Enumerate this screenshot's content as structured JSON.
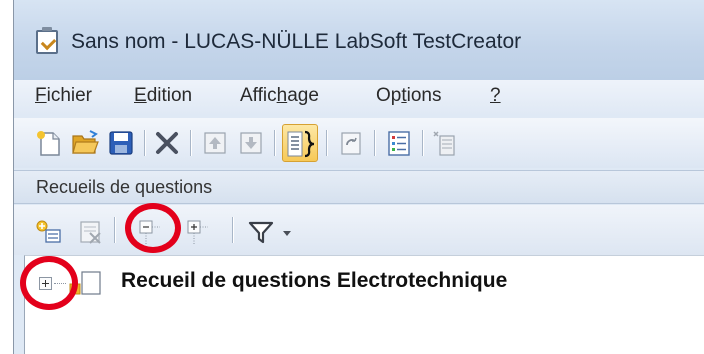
{
  "window": {
    "title": "Sans nom - LUCAS-NÜLLE LabSoft TestCreator"
  },
  "menubar": {
    "items": [
      {
        "label_u": "F",
        "label_rest": "ichier"
      },
      {
        "label_u": "E",
        "label_rest": "dition"
      },
      {
        "label_pre": "Affic",
        "label_u": "h",
        "label_rest": "age"
      },
      {
        "label_pre": "Op",
        "label_u": "t",
        "label_rest": "ions"
      },
      {
        "label_u": "?",
        "label_rest": ""
      }
    ]
  },
  "toolbar": {
    "buttons": [
      "new-icon",
      "open-folder-icon",
      "save-icon",
      "delete-icon",
      "move-up-icon",
      "move-down-icon",
      "view-source-icon",
      "refresh-icon",
      "list-icon",
      "export-icon"
    ]
  },
  "section": {
    "title": "Recueils de questions"
  },
  "subtoolbar": {
    "buttons": [
      "add-collection-icon",
      "remove-collection-icon",
      "collapse-all-icon",
      "expand-all-icon",
      "filter-icon",
      "dropdown-arrow-icon"
    ]
  },
  "tree": {
    "nodes": [
      {
        "label": "Recueil de questions Electrotechnique",
        "expanded": false
      }
    ]
  },
  "colors": {
    "highlight": "#e3001b",
    "titlebar": "#c4d5ea"
  }
}
